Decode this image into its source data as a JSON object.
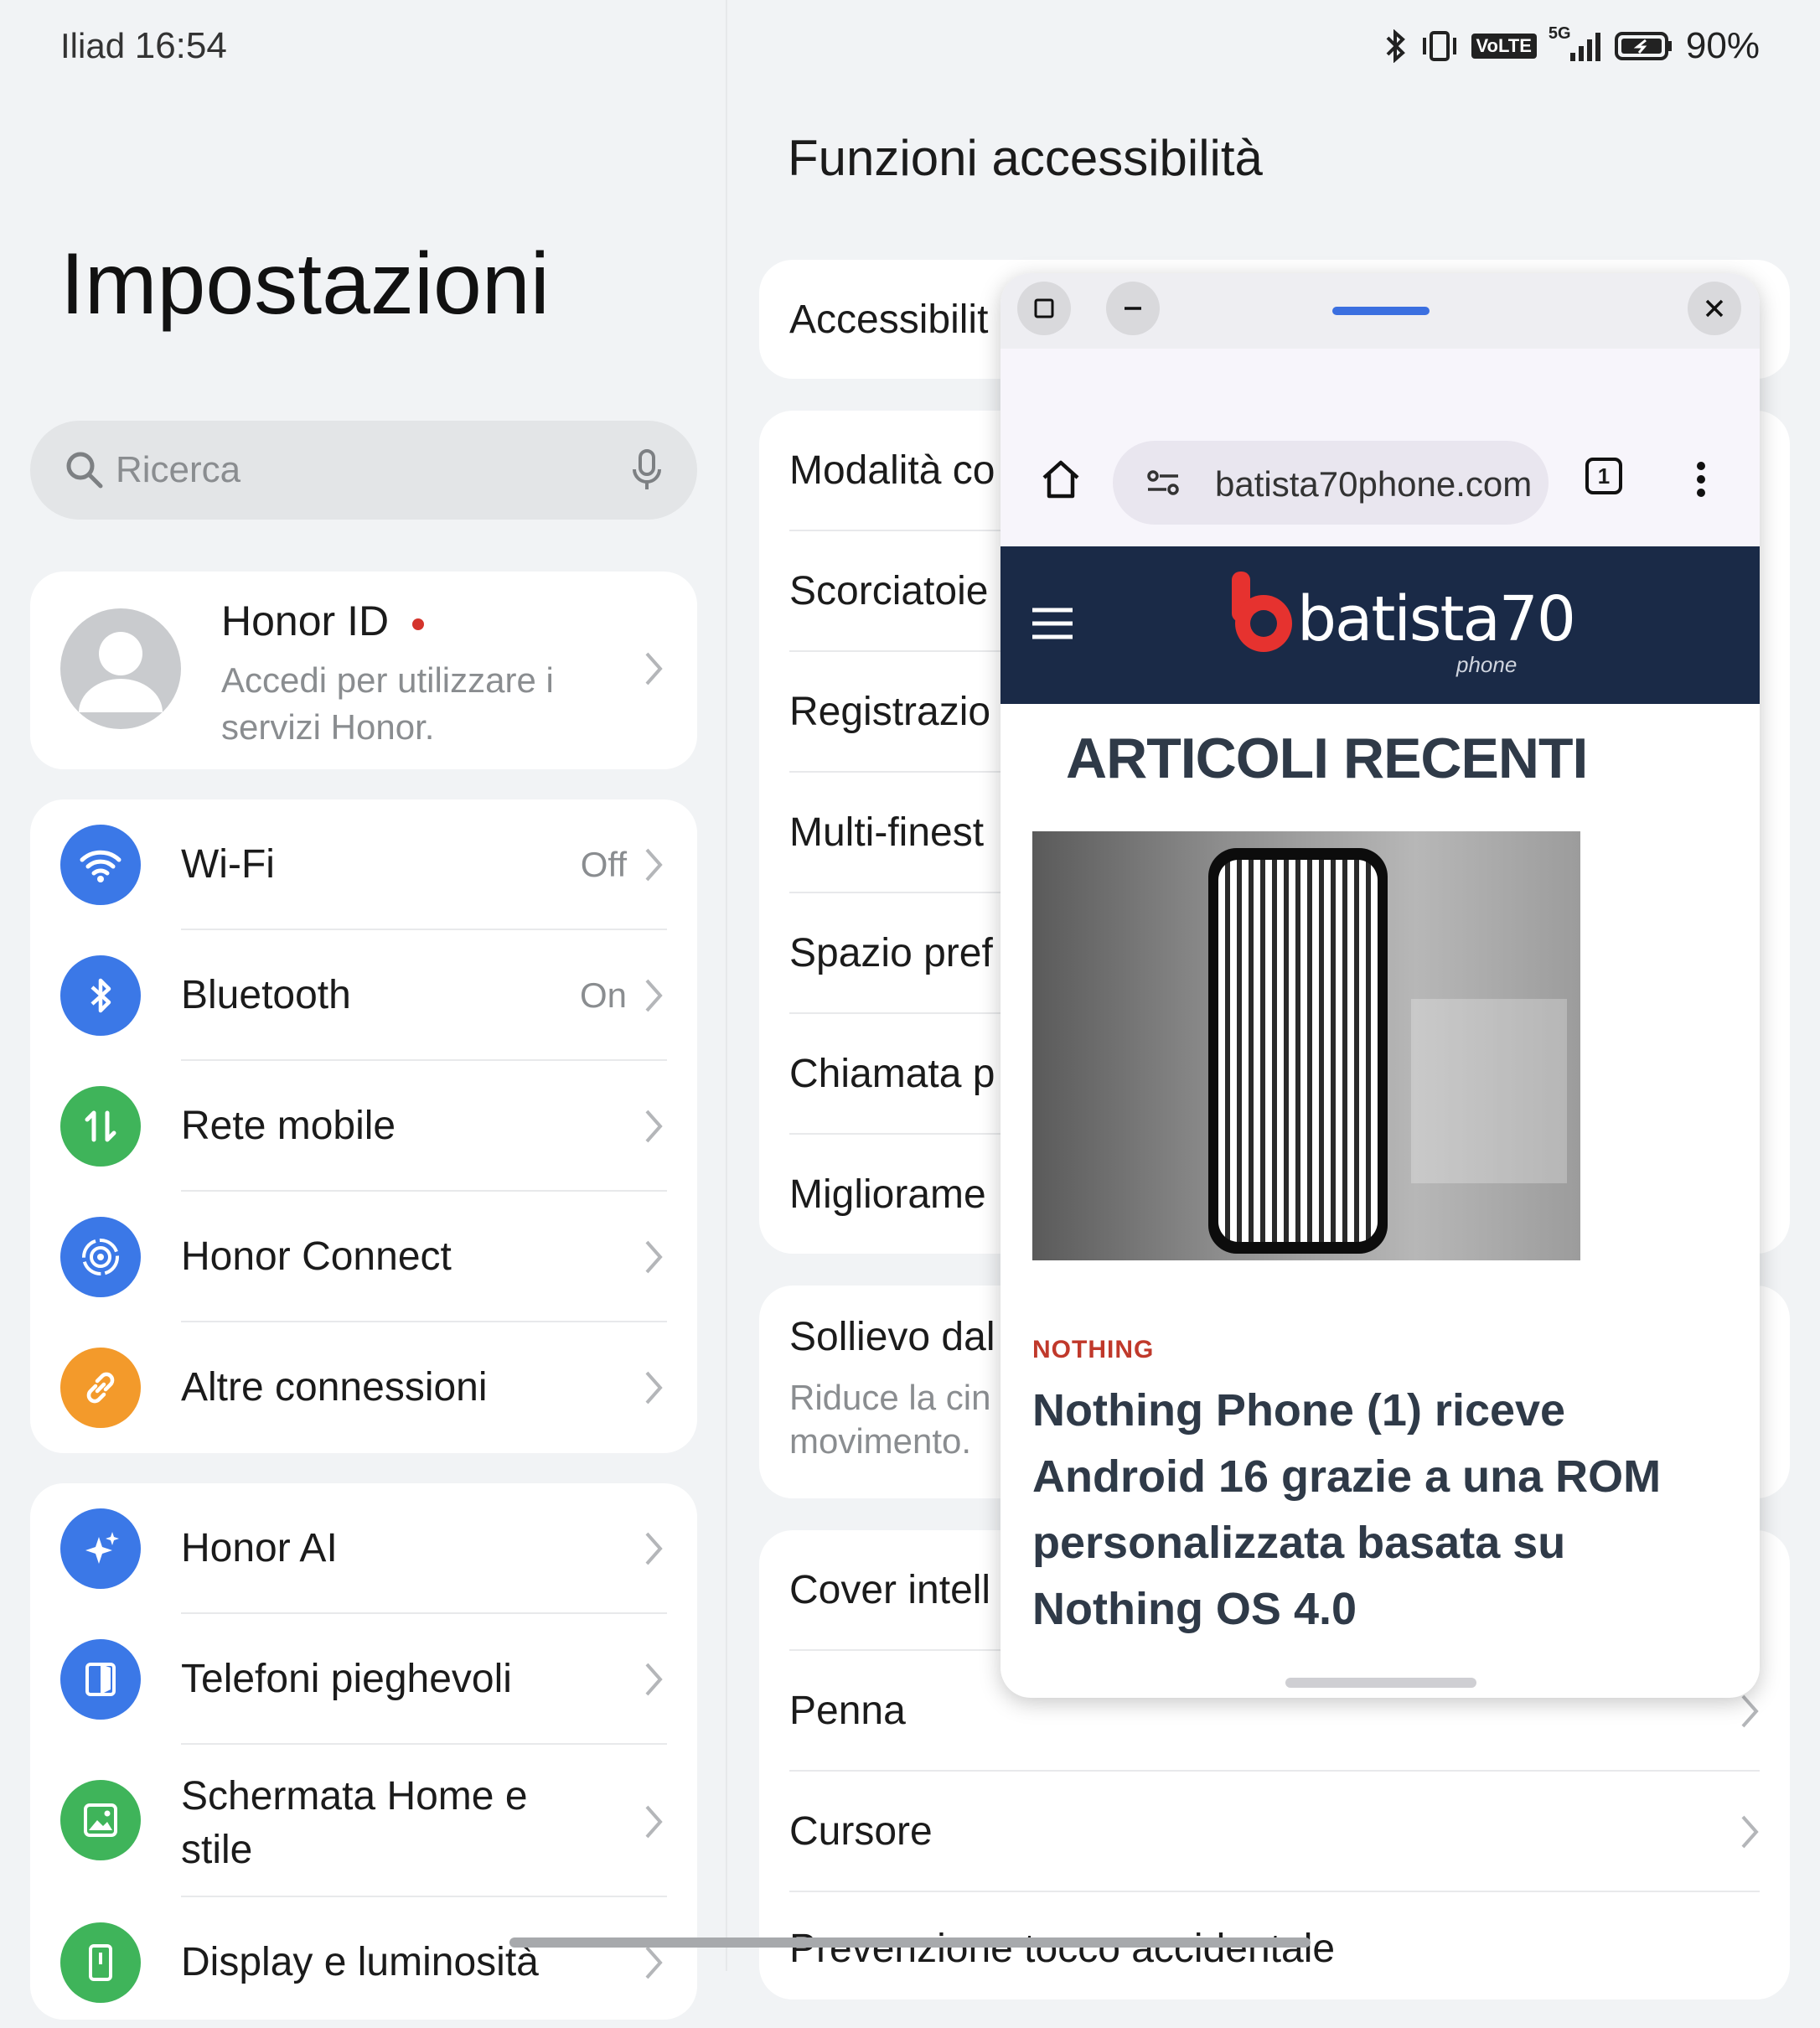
{
  "status_bar": {
    "carrier": "Iliad",
    "time": "16:54",
    "battery": "90%",
    "network": "5G",
    "volte": "VoLTE"
  },
  "left": {
    "title": "Impostazioni",
    "search_placeholder": "Ricerca",
    "account": {
      "name": "Honor ID",
      "subtitle_line1": "Accedi per utilizzare i",
      "subtitle_line2": "servizi Honor."
    },
    "group1": [
      {
        "label": "Wi-Fi",
        "value": "Off",
        "icon": "wifi-icon",
        "color": "#3b78e7"
      },
      {
        "label": "Bluetooth",
        "value": "On",
        "icon": "bluetooth-icon",
        "color": "#3b78e7"
      },
      {
        "label": "Rete mobile",
        "value": "",
        "icon": "mobile-data-icon",
        "color": "#3fb45a"
      },
      {
        "label": "Honor Connect",
        "value": "",
        "icon": "honor-connect-icon",
        "color": "#3b78e7"
      },
      {
        "label": "Altre connessioni",
        "value": "",
        "icon": "link-icon",
        "color": "#f39a2b"
      }
    ],
    "group2": [
      {
        "label": "Honor AI",
        "icon": "ai-sparkle-icon",
        "color": "#3b78e7"
      },
      {
        "label": "Telefoni pieghevoli",
        "icon": "foldable-icon",
        "color": "#3b78e7"
      },
      {
        "label_line1": "Schermata Home e",
        "label_line2": "stile",
        "icon": "image-icon",
        "color": "#3fb45a"
      },
      {
        "label": "Display e luminosità",
        "icon": "display-icon",
        "color": "#3fb45a"
      }
    ]
  },
  "right": {
    "title": "Funzioni accessibilità",
    "card1": [
      "Accessibilit"
    ],
    "card2": [
      "Modalità co",
      "Scorciatoie",
      "Registrazio",
      "Multi-finest",
      "Spazio pref",
      "Chiamata p",
      "Migliorame"
    ],
    "card3": {
      "title": "Sollievo dal",
      "sub_line1": "Riduce la cin",
      "sub_line2": "movimento."
    },
    "card4": [
      "Cover intell",
      "Penna",
      "Cursore",
      "Prevenzione tocco accidentale"
    ]
  },
  "floating_window": {
    "url": "batista70phone.com",
    "tab_count": "1",
    "site_logo_text": "batista70",
    "site_logo_sub": "phone",
    "section_title": "ARTICOLI RECENTI",
    "article": {
      "category": "NOTHING",
      "headline": "Nothing Phone (1) riceve Android 16 grazie a una ROM personalizzata basata su Nothing OS 4.0"
    }
  }
}
